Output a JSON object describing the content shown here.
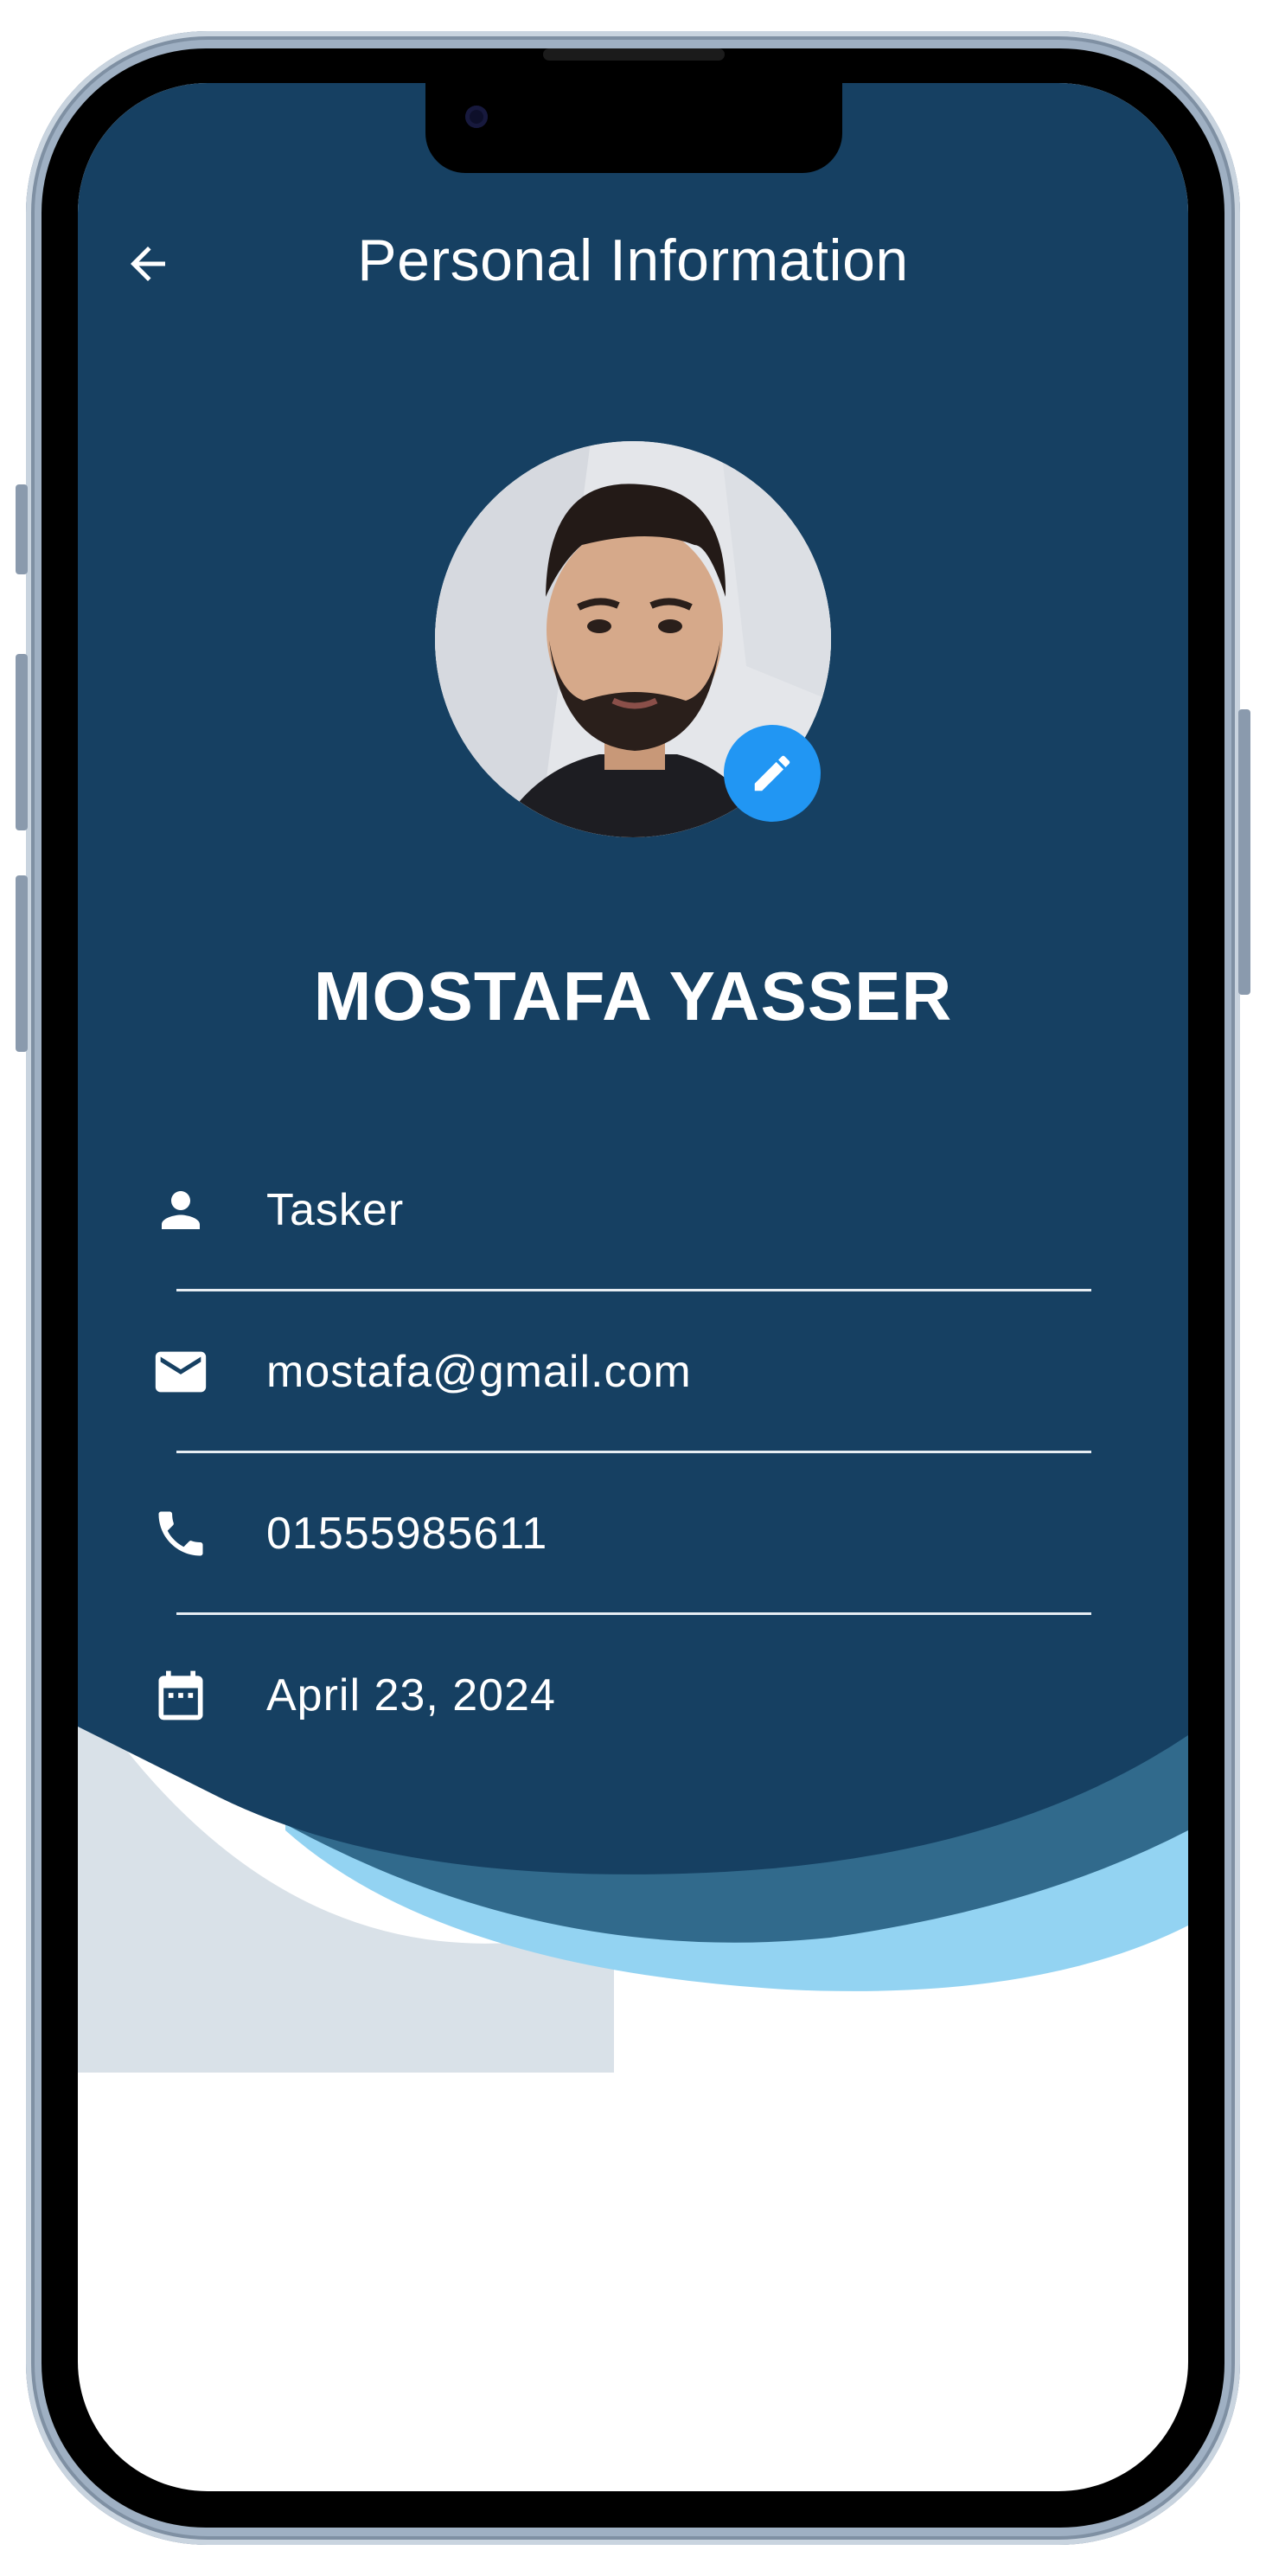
{
  "colors": {
    "header_bg": "#164062",
    "wave_mid": "#316a8c",
    "wave_light": "#93d3f2",
    "wave_grey": "#d9e1e8",
    "accent": "#2196f3",
    "text_on_dark": "#ffffff"
  },
  "app_bar": {
    "title": "Personal Information",
    "back_icon": "arrow-back-icon"
  },
  "profile": {
    "name": "MOSTAFA YASSER",
    "avatar_icon": "avatar-photo",
    "edit_icon": "pencil-icon"
  },
  "info": [
    {
      "icon": "person-icon",
      "value": "Tasker"
    },
    {
      "icon": "email-icon",
      "value": "mostafa@gmail.com"
    },
    {
      "icon": "phone-icon",
      "value": "01555985611"
    },
    {
      "icon": "calendar-icon",
      "value": "April 23, 2024"
    }
  ]
}
